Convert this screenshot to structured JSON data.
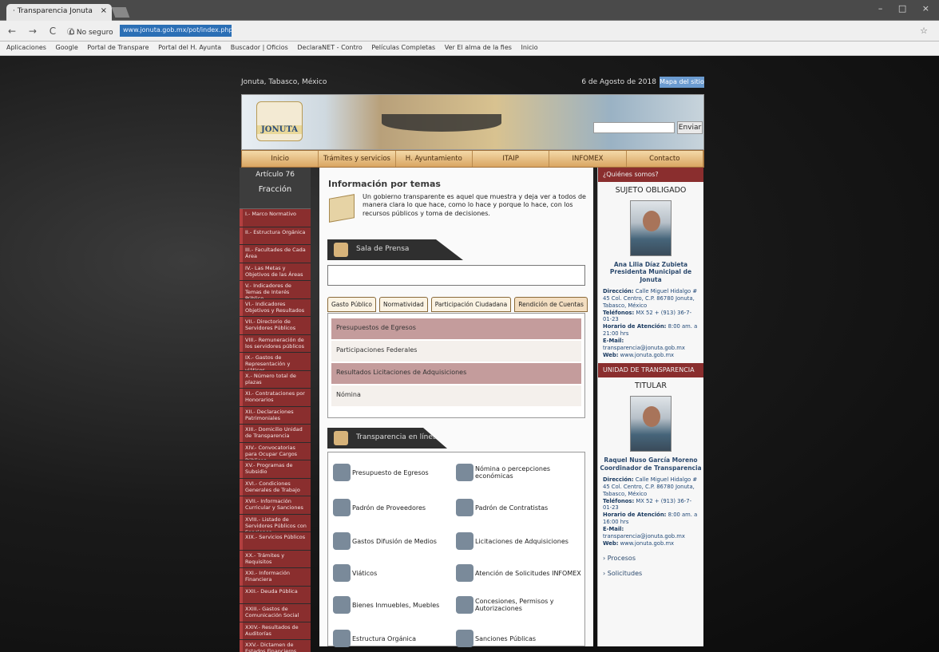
{
  "browser": {
    "tab_title": "· Transparencia Jonuta",
    "tab_close": "×",
    "window_controls": "– □ ×",
    "nav_icons": "← → C ⌂",
    "security": "ⓘ No seguro",
    "url": "www.jonuta.gob.mx/pot/index.php",
    "star": "☆",
    "bookmarks": [
      "Aplicaciones",
      "Google",
      "Portal de Transpare",
      "Portal del H. Ayunta",
      "Buscador | Oficios",
      "DeclaraNET - Contro",
      "Películas Completas",
      "Ver El alma de la fies",
      "Inicio"
    ]
  },
  "header": {
    "location": "Jonuta, Tabasco, México",
    "date": "6 de Agosto de 2018",
    "map_label": "Mapa del sitio",
    "logo_text": "JONUTA",
    "search_button": "Enviar",
    "menu": [
      "Inicio",
      "Trámites y servicios",
      "H. Ayuntamiento",
      "ITAIP",
      "INFOMEX",
      "Contacto"
    ]
  },
  "sidebar": {
    "title": "Artículo 76",
    "subtitle": "Fracción",
    "items": [
      "I.- Marco Normativo",
      "II.- Estructura Orgánica",
      "III.- Facultades de Cada Área",
      "IV.- Las Metas y Objetivos de las Áreas",
      "V.- Indicadores de Temas de Interés Público",
      "VI.- Indicadores Objetivos y Resultados",
      "VII.- Directorio de Servidores Públicos",
      "VIII.- Remuneración de los servidores públicos",
      "IX.- Gastos de Representación y viáticos",
      "X.- Número total de plazas",
      "XI.- Contrataciones por Honorarios",
      "XII.- Declaraciones Patrimoniales",
      "XIII.- Domicilio Unidad de Transparencia",
      "XIV.- Convocatorias para Ocupar Cargos Públicos",
      "XV.- Programas de Subsidio",
      "XVI.- Condiciones Generales de Trabajo",
      "XVII.- Información Curricular y Sanciones",
      "XVIII.- Listado de Servidores Públicos con Sanciones",
      "XIX.- Servicios Públicos",
      "XX.- Trámites y Requisitos",
      "XXI.- Información Financiera",
      "XXII.- Deuda Pública",
      "XXIII.- Gastos de Comunicación Social",
      "XXIV.- Resultados de Auditorías",
      "XXV.- Dictamen de Estados Financieros"
    ]
  },
  "main": {
    "title": "Información por temas",
    "intro": "Un gobierno transparente es aquel que muestra y deja ver a todos de manera clara lo que hace, como lo hace y porque lo hace, con los recursos públicos y toma de decisiones.",
    "press_section": "Sala de Prensa",
    "tabs": [
      "Gasto Público",
      "Normatividad",
      "Participación Ciudadana",
      "Rendición de Cuentas"
    ],
    "list": [
      "Presupuestos de Egresos",
      "Participaciones Federales",
      "Resultados Licitaciones de Adquisiciones",
      "Nómina"
    ],
    "online_section": "Transparencia en línea",
    "online_items": [
      "Presupuesto de Egresos",
      "Nómina o percepciones económicas",
      "Padrón de Proveedores",
      "Padrón de Contratistas",
      "Gastos Difusión de Medios",
      "Licitaciones de Adquisiciones",
      "Viáticos",
      "Atención de Solicitudes INFOMEX",
      "Bienes Inmuebles, Muebles",
      "Concesiones, Permisos y Autorizaciones",
      "Estructura Orgánica",
      "Sanciones Públicas"
    ]
  },
  "right": {
    "header": "¿Quiénes somos?",
    "title1": "SUJETO OBLIGADO",
    "name1": "Ana Lilia Díaz Zubieta",
    "role1": "Presidenta Municipal de Jonuta",
    "addr_label": "Dirección:",
    "addr": "Calle Miguel Hidalgo # 45 Col. Centro, C.P. 86780 Jonuta, Tabasco, México",
    "tel_label": "Teléfonos:",
    "tel": "MX 52 + (913) 36-7-01-23",
    "hours_label": "Horario de Atención:",
    "hours": "8:00 am. a 21:00 hrs",
    "hours2": "8:00 am. a 16:00 hrs",
    "email_label": "E-Mail:",
    "email1": "transparencia@jonuta.gob.mx",
    "email2": "transparencia@jonuta.gob.mx",
    "web_label": "Web:",
    "web": "www.jonuta.gob.mx",
    "unit_header": "UNIDAD DE TRANSPARENCIA",
    "title2": "TITULAR",
    "name2": "Raquel Nuso García Moreno",
    "role2": "Coordinador de Transparencia",
    "link1": "› Procesos",
    "link2": "› Solicitudes"
  },
  "colors": {
    "sidebar_item": "#8a2e2e",
    "menu": "#d9a562",
    "url_highlight": "#2b6fb5"
  }
}
